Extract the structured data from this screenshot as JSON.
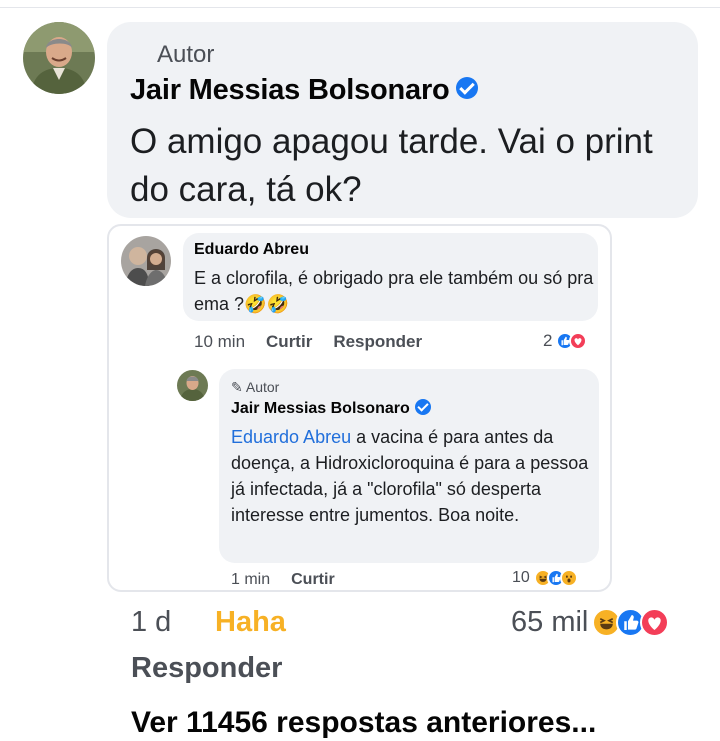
{
  "main_comment": {
    "badge": "Autor",
    "author": "Jair Messias Bolsonaro",
    "text": "O amigo apagou tarde. Vai o print do cara, tá ok?",
    "time": "1 d",
    "reaction_label": "Haha",
    "reaction_count": "65 mil",
    "reactions": [
      "haha-icon",
      "like-icon",
      "love-icon"
    ],
    "reply_label": "Responder"
  },
  "shared_comment": {
    "author": "Eduardo Abreu",
    "text": "E  a clorofila, é  obrigado pra ele também ou só  pra ema ?🤣🤣",
    "time": "10 min",
    "like_label": "Curtir",
    "reply_label": "Responder",
    "reaction_count": "2",
    "reactions": [
      "like-icon",
      "love-icon"
    ]
  },
  "shared_reply": {
    "badge": "Autor",
    "author": "Jair Messias Bolsonaro",
    "mention": "Eduardo Abreu",
    "text": " a vacina é para antes da doença, a Hidroxicloroquina é para a pessoa já infectada, já a \"clorofila\" só desperta interesse entre jumentos. Boa noite.",
    "time": "1 min",
    "like_label": "Curtir",
    "reaction_count": "10",
    "reactions": [
      "haha-icon",
      "like-icon",
      "wow-icon"
    ]
  },
  "more_replies": "Ver 11456 respostas anteriores...",
  "colors": {
    "bubble": "#f0f2f5",
    "link": "#216fdb",
    "haha": "#f7b125",
    "verified": "#1877f2",
    "secondary_text": "#4b4f56"
  }
}
